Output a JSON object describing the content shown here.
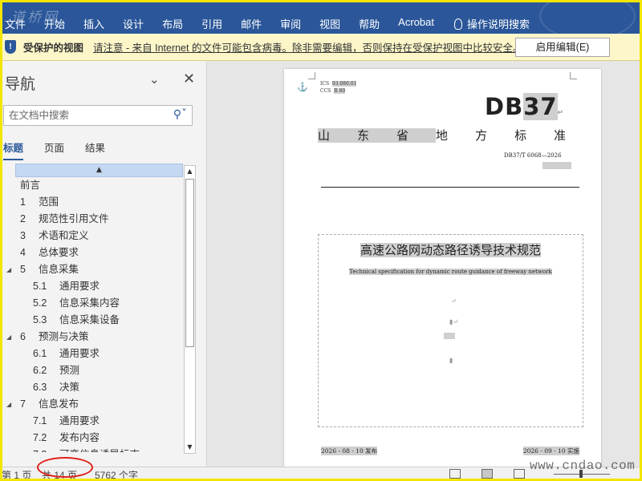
{
  "ribbon": {
    "watermark": "道桥网",
    "tabs": [
      "文件",
      "开始",
      "插入",
      "设计",
      "布局",
      "引用",
      "邮件",
      "审阅",
      "视图",
      "帮助",
      "Acrobat"
    ],
    "tell_me": "操作说明搜索"
  },
  "protected_bar": {
    "title": "受保护的视图",
    "message": "请注意 - 来自 Internet 的文件可能包含病毒。除非需要编辑，否则保持在受保护视图中比较安全。",
    "enable_button": "启用编辑(E)"
  },
  "nav": {
    "title": "导航",
    "search_placeholder": "在文档中搜索",
    "tabs": [
      "标题",
      "页面",
      "结果"
    ],
    "items": [
      {
        "num": "",
        "label": "前言"
      },
      {
        "num": "1",
        "label": "范围"
      },
      {
        "num": "2",
        "label": "规范性引用文件"
      },
      {
        "num": "3",
        "label": "术语和定义"
      },
      {
        "num": "4",
        "label": "总体要求"
      },
      {
        "num": "5",
        "label": "信息采集"
      },
      {
        "num": "5.1",
        "label": "通用要求"
      },
      {
        "num": "5.2",
        "label": "信息采集内容"
      },
      {
        "num": "5.3",
        "label": "信息采集设备"
      },
      {
        "num": "6",
        "label": "预测与决策"
      },
      {
        "num": "6.1",
        "label": "通用要求"
      },
      {
        "num": "6.2",
        "label": "预测"
      },
      {
        "num": "6.3",
        "label": "决策"
      },
      {
        "num": "7",
        "label": "信息发布"
      },
      {
        "num": "7.1",
        "label": "通用要求"
      },
      {
        "num": "7.2",
        "label": "发布内容"
      },
      {
        "num": "7.3",
        "label": "可变信息诱导标志"
      }
    ]
  },
  "document": {
    "ics": "ICS",
    "ics_val": "93.080.01",
    "ccs": "CCS",
    "ccs_val": "R 80",
    "db_prefix": "DB",
    "db_num": "37",
    "std_chars": [
      "山",
      "东",
      "省",
      "地",
      "方",
      "标",
      "准"
    ],
    "std_number": "DB37/T 6068—2026",
    "title_cn": "高速公路网动态路径诱导技术规范",
    "title_en": "Technical specification for dynamic route guidance of freeway network",
    "publish": "2026 - 08 - 10 发布",
    "implement": "2026 - 09 - 10 实施"
  },
  "status": {
    "page": "第 1 页",
    "total": "共 14 页",
    "words": "5762 个字"
  },
  "corner_watermark": "www.cndao.com",
  "colors": {
    "ribbon": "#2b579a",
    "protected_bar": "#fcf6c9",
    "frame": "#f2e600",
    "highlight": "#e0211a"
  }
}
